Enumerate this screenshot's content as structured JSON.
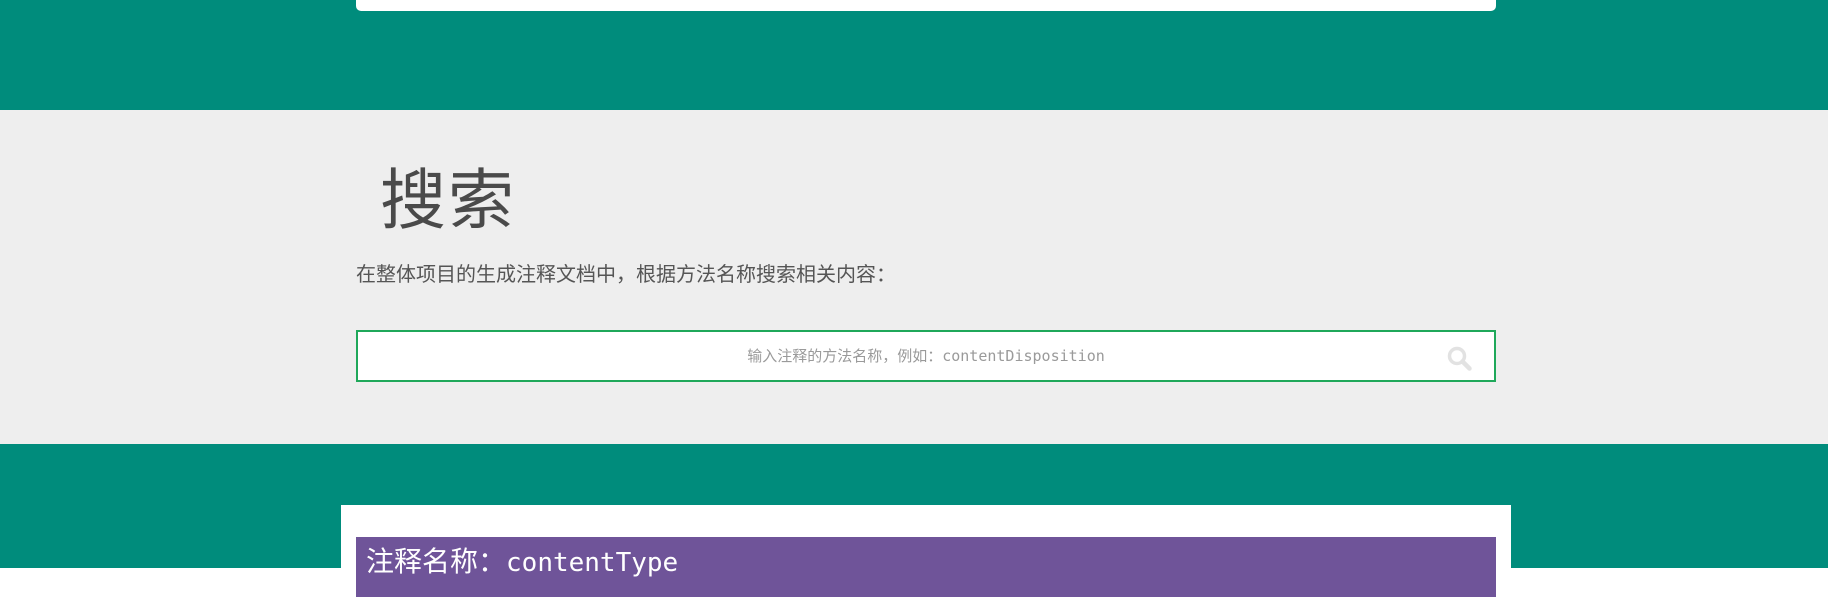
{
  "search": {
    "title": "搜索",
    "description": "在整体项目的生成注释文档中，根据方法名称搜索相关内容：",
    "placeholder": "输入注释的方法名称，例如：contentDisposition",
    "icon": "search-icon"
  },
  "result": {
    "label": "注释名称：",
    "name": "contentType"
  },
  "colors": {
    "teal_band": "#008c7c",
    "search_bg": "#eeeeee",
    "input_border": "#1fa85a",
    "result_header": "#6f5499"
  }
}
